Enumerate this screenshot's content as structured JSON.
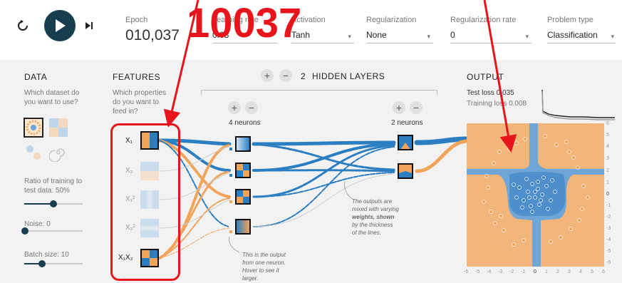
{
  "controls": {
    "reset_icon": "reset-icon",
    "play_icon": "play-icon",
    "step_icon": "step-icon"
  },
  "epoch": {
    "label": "Epoch",
    "value": "010,037"
  },
  "settings": [
    {
      "label": "Learning rate",
      "value": "0.03"
    },
    {
      "label": "Activation",
      "value": "Tanh"
    },
    {
      "label": "Regularization",
      "value": "None"
    },
    {
      "label": "Regularization rate",
      "value": "0"
    },
    {
      "label": "Problem type",
      "value": "Classification"
    }
  ],
  "data_panel": {
    "title": "DATA",
    "desc1": "Which dataset do",
    "desc2": "you want to use?",
    "ratio_label1": "Ratio of training to",
    "ratio_label2": "test data:  50%",
    "ratio_value": 0.5,
    "noise_label": "Noise:  0",
    "noise_value": 0,
    "batch_label": "Batch size:  10",
    "batch_value": 0.3
  },
  "features_panel": {
    "title": "FEATURES",
    "desc1": "Which properties",
    "desc2": "do you want to",
    "desc3": "feed in?",
    "features": [
      "X₁",
      "X₂",
      "X₁²",
      "X₂²",
      "X₁X₂"
    ]
  },
  "network": {
    "plus": "+",
    "minus": "−",
    "hidden_layers_count": "2",
    "hidden_layers_label": "HIDDEN LAYERS",
    "layer1_neurons": "4 neurons",
    "layer2_neurons": "2 neurons",
    "note_weights": [
      "The outputs are",
      "mixed with varying",
      "weights, shown",
      "by the thickness",
      "of the lines."
    ],
    "note_neuron": [
      "This is the output",
      "from one neuron.",
      "Hover to see it",
      "larger."
    ]
  },
  "output_panel": {
    "title": "OUTPUT",
    "test_loss": "Test loss 0.035",
    "training_loss": "Training loss 0.008",
    "y_ticks": [
      "6",
      "5",
      "4",
      "3",
      "2",
      "1",
      "0",
      "-1",
      "-2",
      "-3",
      "-4",
      "-5",
      "-6"
    ],
    "x_ticks": [
      "-6",
      "-5",
      "-4",
      "-3",
      "-2",
      "-1",
      "0",
      "1",
      "2",
      "3",
      "4",
      "5",
      "6"
    ]
  },
  "annotation": {
    "text": "10037",
    "color": "#e8141b"
  },
  "colors": {
    "orange": "#f2a45a",
    "blue": "#2b7ec2",
    "dark": "#183d4e"
  }
}
